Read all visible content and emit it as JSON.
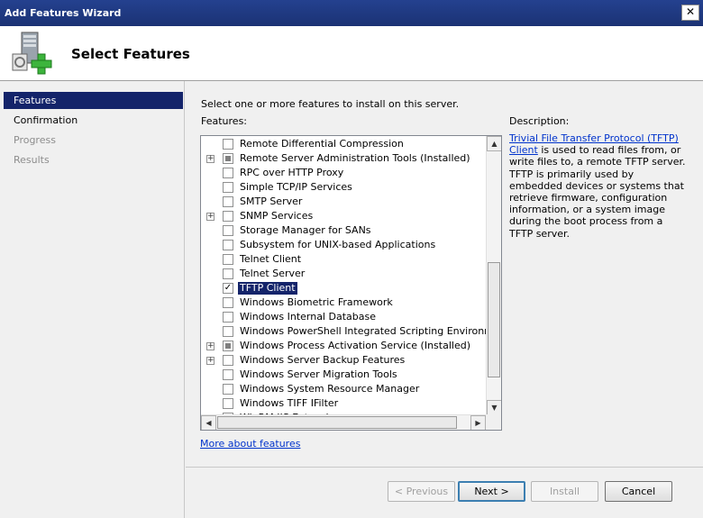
{
  "window": {
    "title": "Add Features Wizard",
    "close_glyph": "✕"
  },
  "header": {
    "title": "Select Features",
    "icon": "server-add-icon"
  },
  "steps": [
    {
      "label": "Features",
      "state": "active"
    },
    {
      "label": "Confirmation",
      "state": "enabled"
    },
    {
      "label": "Progress",
      "state": "disabled"
    },
    {
      "label": "Results",
      "state": "disabled"
    }
  ],
  "main": {
    "intro": "Select one or more features to install on this server.",
    "features_label": "Features:",
    "features": [
      {
        "label": "Remote Differential Compression",
        "expander": false,
        "check": "none"
      },
      {
        "label": "Remote Server Administration Tools  (Installed)",
        "expander": true,
        "check": "partial"
      },
      {
        "label": "RPC over HTTP Proxy",
        "expander": false,
        "check": "none"
      },
      {
        "label": "Simple TCP/IP Services",
        "expander": false,
        "check": "none"
      },
      {
        "label": "SMTP Server",
        "expander": false,
        "check": "none"
      },
      {
        "label": "SNMP Services",
        "expander": true,
        "check": "none"
      },
      {
        "label": "Storage Manager for SANs",
        "expander": false,
        "check": "none"
      },
      {
        "label": "Subsystem for UNIX-based Applications",
        "expander": false,
        "check": "none"
      },
      {
        "label": "Telnet Client",
        "expander": false,
        "check": "none"
      },
      {
        "label": "Telnet Server",
        "expander": false,
        "check": "none"
      },
      {
        "label": "TFTP Client",
        "expander": false,
        "check": "checked",
        "selected": true
      },
      {
        "label": "Windows Biometric Framework",
        "expander": false,
        "check": "none"
      },
      {
        "label": "Windows Internal Database",
        "expander": false,
        "check": "none"
      },
      {
        "label": "Windows PowerShell Integrated Scripting Environment (IS",
        "expander": false,
        "check": "none"
      },
      {
        "label": "Windows Process Activation Service  (Installed)",
        "expander": true,
        "check": "partial"
      },
      {
        "label": "Windows Server Backup Features",
        "expander": true,
        "check": "none"
      },
      {
        "label": "Windows Server Migration Tools",
        "expander": false,
        "check": "none"
      },
      {
        "label": "Windows System Resource Manager",
        "expander": false,
        "check": "none"
      },
      {
        "label": "Windows TIFF IFilter",
        "expander": false,
        "check": "none"
      },
      {
        "label": "WinRM IIS Extension",
        "expander": false,
        "check": "none"
      }
    ],
    "description_label": "Description:",
    "description_link": "Trivial File Transfer Protocol (TFTP) Client",
    "description_text": " is used to read files from, or write files to, a remote TFTP server. TFTP is primarily used by embedded devices or systems that retrieve firmware, configuration information, or a system image during the boot process from a TFTP server.",
    "more_link": "More about features"
  },
  "buttons": {
    "previous": "< Previous",
    "next": "Next >",
    "install": "Install",
    "cancel": "Cancel"
  },
  "scroll": {
    "up_glyph": "▲",
    "down_glyph": "▼",
    "left_glyph": "◀",
    "right_glyph": "▶"
  }
}
